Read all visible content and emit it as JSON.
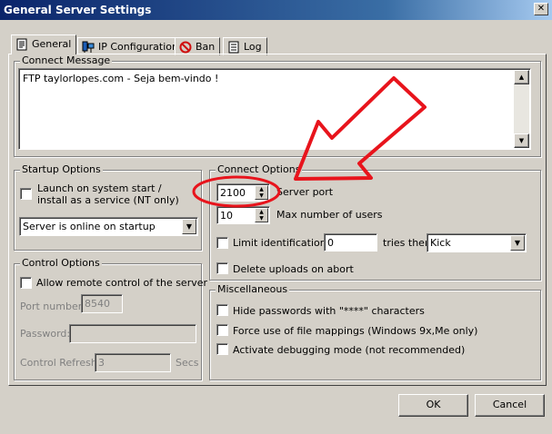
{
  "window": {
    "title": "General Server Settings",
    "close_symbol": "✕"
  },
  "tabs": [
    {
      "label": "General",
      "icon": "document-icon",
      "active": true
    },
    {
      "label": "IP Configuration",
      "icon": "network-computer-icon",
      "active": false
    },
    {
      "label": "Ban",
      "icon": "ban-icon",
      "active": false
    },
    {
      "label": "Log",
      "icon": "notepad-icon",
      "active": false
    }
  ],
  "connect_message": {
    "label": "Connect Message",
    "value": "FTP taylorlopes.com - Seja bem-vindo !"
  },
  "startup_options": {
    "label": "Startup Options",
    "launch_line1": "Launch on system start /",
    "launch_line2": "install as a service (NT only)",
    "launch_checked": false,
    "mode_selected": "Server is online on startup"
  },
  "control_options": {
    "label": "Control Options",
    "allow_remote_label": "Allow remote control of the server",
    "allow_remote_checked": false,
    "port_label": "Port number:",
    "port_value": "8540",
    "password_label": "Password:",
    "password_value": "",
    "refresh_label": "Control Refresh:",
    "refresh_value": "3",
    "refresh_unit": "Secs"
  },
  "connect_options": {
    "label": "Connect Options",
    "server_port_value": "2100",
    "server_port_label": "Server port",
    "max_users_value": "10",
    "max_users_label": "Max number of users",
    "limit_ident_label": "Limit identification to",
    "limit_ident_checked": false,
    "limit_ident_value": "0",
    "tries_then_label": "tries then",
    "tries_action_selected": "Kick",
    "delete_uploads_label": "Delete uploads on abort",
    "delete_uploads_checked": false
  },
  "miscellaneous": {
    "label": "Miscellaneous",
    "hide_passwords_label": "Hide passwords with \"****\" characters",
    "force_mappings_label": "Force use of file mappings (Windows 9x,Me only)",
    "debug_mode_label": "Activate debugging mode (not recommended)"
  },
  "buttons": {
    "ok": "OK",
    "cancel": "Cancel"
  },
  "annotation": {
    "color": "#e8141c"
  }
}
